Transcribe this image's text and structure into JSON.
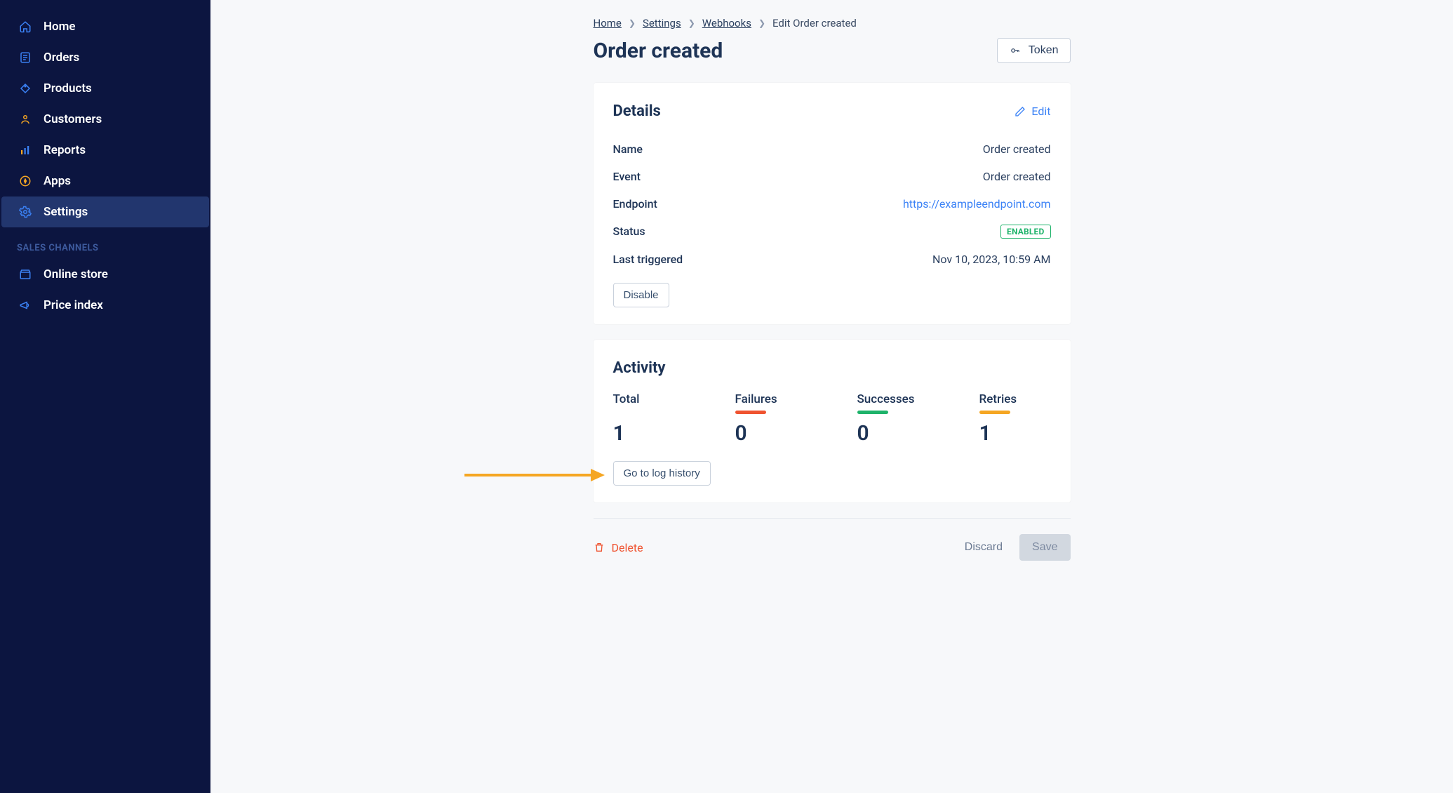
{
  "sidebar": {
    "items": [
      {
        "label": "Home"
      },
      {
        "label": "Orders"
      },
      {
        "label": "Products"
      },
      {
        "label": "Customers"
      },
      {
        "label": "Reports"
      },
      {
        "label": "Apps"
      },
      {
        "label": "Settings"
      }
    ],
    "section_label": "SALES CHANNELS",
    "channels": [
      {
        "label": "Online store"
      },
      {
        "label": "Price index"
      }
    ]
  },
  "breadcrumbs": {
    "items": [
      {
        "label": "Home",
        "link": true
      },
      {
        "label": "Settings",
        "link": true
      },
      {
        "label": "Webhooks",
        "link": true
      },
      {
        "label": "Edit Order created",
        "link": false
      }
    ]
  },
  "page": {
    "title": "Order created",
    "token_button": "Token"
  },
  "details": {
    "title": "Details",
    "edit_label": "Edit",
    "rows": {
      "name_label": "Name",
      "name_value": "Order created",
      "event_label": "Event",
      "event_value": "Order created",
      "endpoint_label": "Endpoint",
      "endpoint_value": "https://exampleendpoint.com",
      "status_label": "Status",
      "status_badge": "ENABLED",
      "last_triggered_label": "Last triggered",
      "last_triggered_value": "Nov 10, 2023, 10:59 AM"
    },
    "disable_button": "Disable"
  },
  "activity": {
    "title": "Activity",
    "stats": {
      "total_label": "Total",
      "total_value": "1",
      "failures_label": "Failures",
      "failures_value": "0",
      "successes_label": "Successes",
      "successes_value": "0",
      "retries_label": "Retries",
      "retries_value": "1"
    },
    "log_button": "Go to log history"
  },
  "actions": {
    "delete_label": "Delete",
    "discard_label": "Discard",
    "save_label": "Save"
  }
}
